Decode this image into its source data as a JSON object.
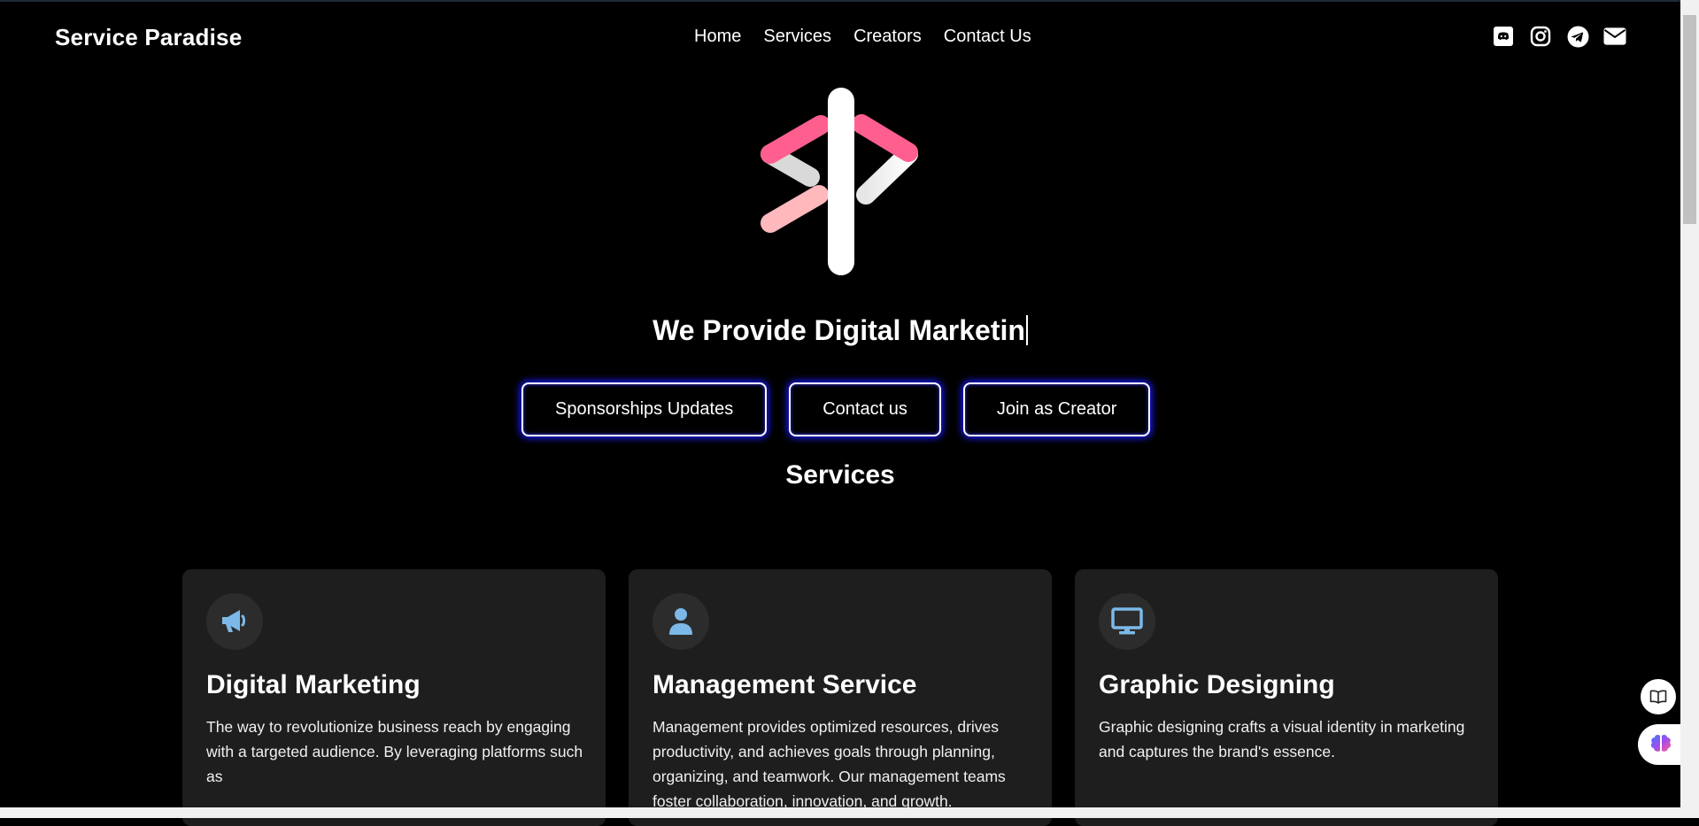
{
  "nav": {
    "brand": "Service Paradise",
    "links": [
      "Home",
      "Services",
      "Creators",
      "Contact Us"
    ],
    "social_icons": [
      "discord-icon",
      "instagram-icon",
      "telegram-icon",
      "envelope-icon"
    ]
  },
  "hero": {
    "logo": "service-paradise-logo",
    "tagline": "We Provide Digital Marketin",
    "buttons": [
      "Sponsorships Updates",
      "Contact us",
      "Join as Creator"
    ]
  },
  "services": {
    "title": "Services",
    "cards": [
      {
        "icon": "megaphone-icon",
        "title": "Digital Marketing",
        "text": "The way to revolutionize business reach by engaging with a targeted audience. By leveraging platforms such as"
      },
      {
        "icon": "user-icon",
        "title": "Management Service",
        "text": "Management provides optimized resources, drives productivity, and achieves goals through planning, organizing, and teamwork. Our management teams foster collaboration, innovation, and growth."
      },
      {
        "icon": "monitor-icon",
        "title": "Graphic Designing",
        "text": "Graphic designing crafts a visual identity in marketing and captures the brand's essence."
      }
    ]
  },
  "floating": {
    "book_icon": "book-icon",
    "brain_icon": "brain-icon"
  },
  "colors": {
    "accent_pink": "#ff5c8a",
    "accent_light_pink": "#ffb3b8",
    "button_glow": "#1a1aff",
    "icon_blue": "#7cb9e8",
    "card_bg": "#1e1e1e"
  }
}
